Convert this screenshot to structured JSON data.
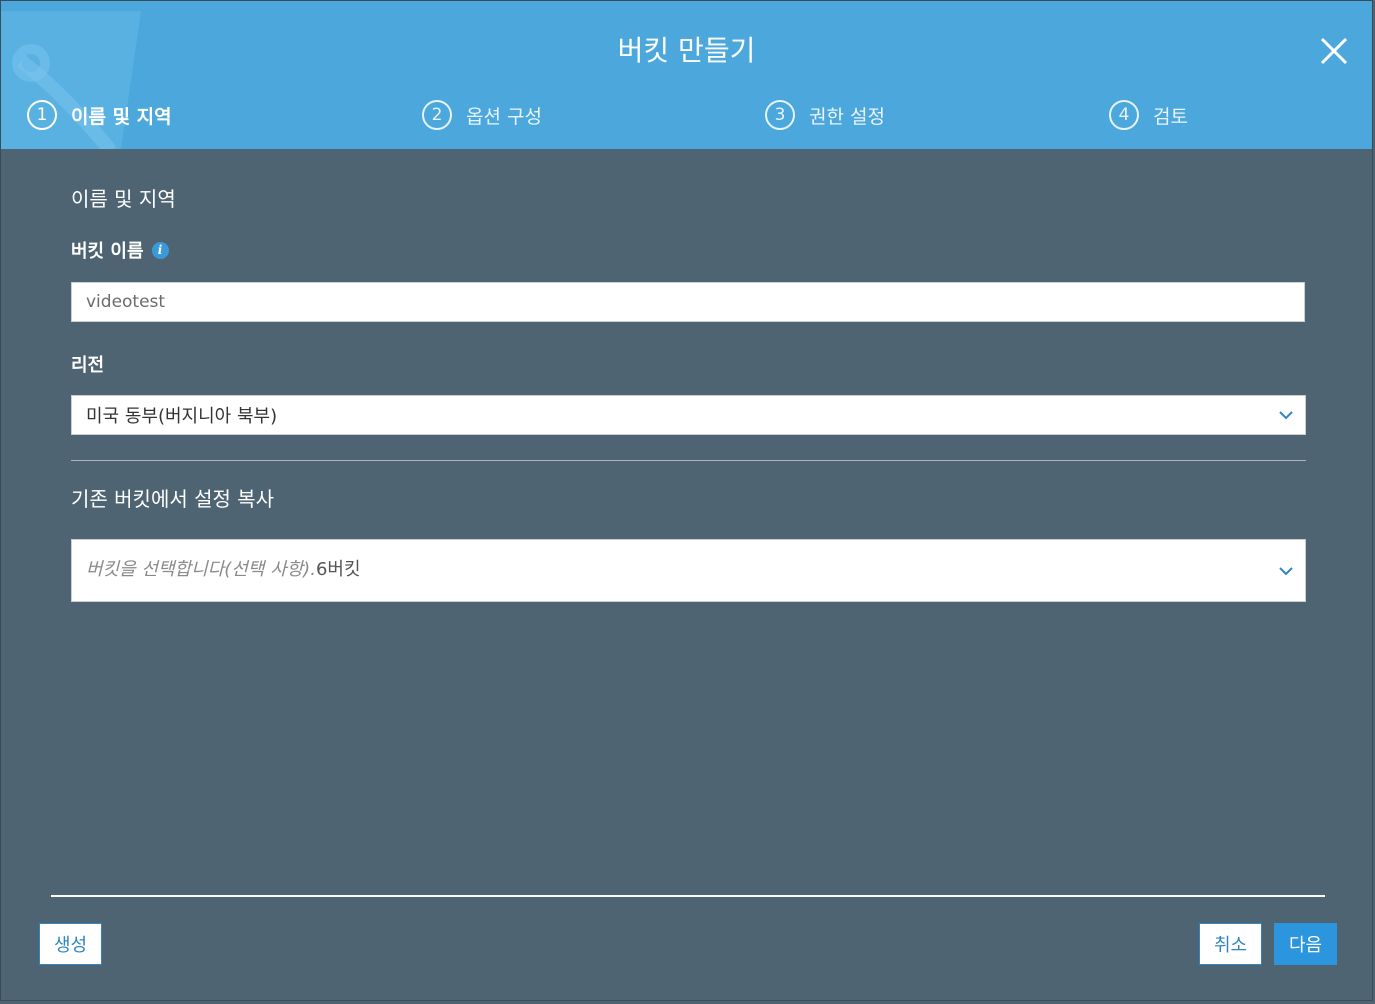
{
  "modal": {
    "title": "버킷 만들기"
  },
  "steps": [
    {
      "number": "1",
      "label": "이름 및 지역",
      "state": "active"
    },
    {
      "number": "2",
      "label": "옵션 구성",
      "state": "inactive"
    },
    {
      "number": "3",
      "label": "권한 설정",
      "state": "inactive"
    },
    {
      "number": "4",
      "label": "검토",
      "state": "inactive"
    }
  ],
  "form": {
    "section_title": "이름 및 지역",
    "bucket_name_label": "버킷 이름",
    "bucket_name_value": "videotest",
    "region_label": "리전",
    "region_value": "미국 동부(버지니아 북부)",
    "copy_section_title": "기존 버킷에서 설정 복사",
    "copy_placeholder": "버킷을 선택합니다(선택 사항).",
    "copy_count": "6버킷"
  },
  "footer": {
    "create_label": "생성",
    "cancel_label": "취소",
    "next_label": "다음"
  },
  "colors": {
    "header": "#4ca8dc",
    "body": "#4f6473",
    "primary": "#2b96dd"
  },
  "icons": {
    "close": "close-icon",
    "info": "info-icon",
    "chevron": "chevron-down-icon"
  }
}
